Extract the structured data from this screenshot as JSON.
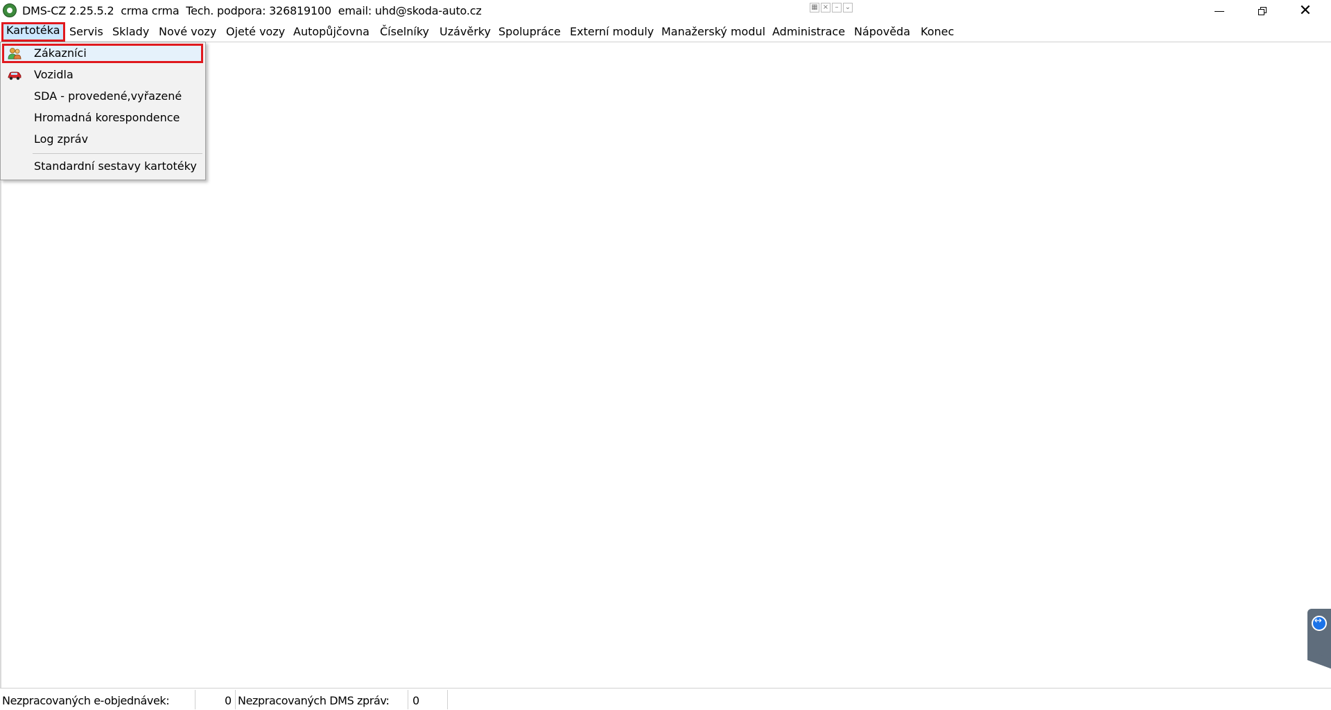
{
  "window": {
    "title": "DMS-CZ 2.25.5.2  crma crma  Tech. podpora: 326819100  email: uhd@skoda-auto.cz",
    "app_icon": "skoda-logo-icon",
    "controls": {
      "minimize": "minimize-icon",
      "restore": "restore-icon",
      "close": "close-icon"
    }
  },
  "menubar": {
    "items": [
      {
        "label": "Kartotéka"
      },
      {
        "label": "Servis"
      },
      {
        "label": "Sklady"
      },
      {
        "label": "Nové vozy"
      },
      {
        "label": "Ojeté vozy"
      },
      {
        "label": "Autopůjčovna"
      },
      {
        "label": "Číselníky"
      },
      {
        "label": "Uzávěrky"
      },
      {
        "label": "Spolupráce"
      },
      {
        "label": "Externí moduly"
      },
      {
        "label": "Manažerský modul"
      },
      {
        "label": "Administrace"
      },
      {
        "label": "Nápověda"
      },
      {
        "label": "Konec"
      }
    ],
    "active_index": 0
  },
  "dropdown": {
    "items": [
      {
        "label": "Zákazníci",
        "icon": "customers-icon",
        "highlighted": true
      },
      {
        "label": "Vozidla",
        "icon": "car-icon"
      },
      {
        "label": "SDA - provedené,vyřazené"
      },
      {
        "label": "Hromadná korespondence"
      },
      {
        "label": "Log zpráv"
      },
      {
        "label": "Standardní sestavy kartotéky"
      }
    ]
  },
  "statusbar": {
    "eorders_label": "Nezpracovaných e-objednávek:",
    "eorders_value": "0",
    "dms_label": "Nezpracovaných DMS zpráv:",
    "dms_value": "0"
  },
  "colors": {
    "highlight_border": "#e0191e",
    "menu_active_bg": "#cce8ff",
    "dropdown_bg": "#f2f2f2"
  }
}
